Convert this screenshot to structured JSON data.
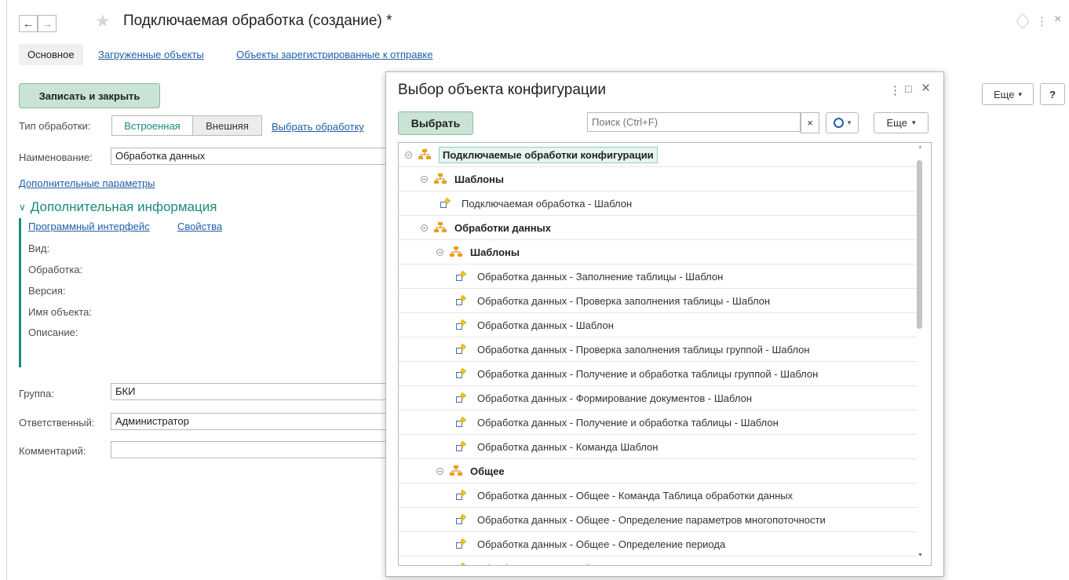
{
  "window": {
    "title": "Подключаемая обработка (создание) *",
    "back": "←",
    "forward": "→",
    "star": "★",
    "link_icon": "🔗",
    "more_icon": "⋮",
    "close_icon": "×"
  },
  "tabs": [
    {
      "label": "Основное"
    },
    {
      "label": "Загруженные объекты"
    },
    {
      "label": "Объекты зарегистрированные к отправке"
    }
  ],
  "toolbar": {
    "save_close": "Записать и закрыть",
    "more": "Еще",
    "help": "?"
  },
  "form": {
    "type_label": "Тип обработки:",
    "type_builtin": "Встроенная",
    "type_external": "Внешняя",
    "choose_processing": "Выбрать обработку",
    "name_label": "Наименование:",
    "name_value": "Обработка данных",
    "extra_params": "Дополнительные параметры",
    "extra_info_title": "Дополнительная информация",
    "program_interface": "Программный интерфейс",
    "properties": "Свойства",
    "kind_label": "Вид:",
    "processing_label": "Обработка:",
    "version_label": "Версия:",
    "object_name_label": "Имя объекта:",
    "description_label": "Описание:",
    "group_label": "Группа:",
    "group_value": "БКИ",
    "responsible_label": "Ответственный:",
    "responsible_value": "Администратор",
    "comment_label": "Комментарий:",
    "comment_value": ""
  },
  "dialog": {
    "title": "Выбор объекта конфигурации",
    "select_button": "Выбрать",
    "search_placeholder": "Поиск (Ctrl+F)",
    "clear_icon": "×",
    "search_icon": "🔍",
    "more": "Еще",
    "dropdown_arrow": "▾",
    "menu_icon": "⋮",
    "maximize_icon": "□",
    "close_icon": "×",
    "tree": [
      {
        "label": "Подключаемые обработки конфигурации",
        "type": "folder",
        "level": 0,
        "selected": true
      },
      {
        "label": "Шаблоны",
        "type": "folder",
        "level": 1
      },
      {
        "label": "Подключаемая обработка - Шаблон",
        "type": "item",
        "level": 2
      },
      {
        "label": "Обработки данных",
        "type": "folder",
        "level": 1
      },
      {
        "label": "Шаблоны",
        "type": "folder",
        "level": 2
      },
      {
        "label": "Обработка данных - Заполнение таблицы - Шаблон",
        "type": "item",
        "level": 3
      },
      {
        "label": "Обработка данных - Проверка заполнения таблицы - Шаблон",
        "type": "item",
        "level": 3
      },
      {
        "label": "Обработка данных - Шаблон",
        "type": "item",
        "level": 3
      },
      {
        "label": "Обработка данных - Проверка заполнения таблицы группой - Шаблон",
        "type": "item",
        "level": 3
      },
      {
        "label": "Обработка данных - Получение и обработка таблицы группой - Шаблон",
        "type": "item",
        "level": 3
      },
      {
        "label": "Обработка данных - Формирование документов - Шаблон",
        "type": "item",
        "level": 3
      },
      {
        "label": "Обработка данных - Получение и обработка таблицы - Шаблон",
        "type": "item",
        "level": 3
      },
      {
        "label": "Обработка данных - Команда Шаблон",
        "type": "item",
        "level": 3
      },
      {
        "label": "Общее",
        "type": "folder",
        "level": 2
      },
      {
        "label": "Обработка данных - Общее - Команда Таблица обработки данных",
        "type": "item",
        "level": 3
      },
      {
        "label": "Обработка данных - Общее - Определение параметров многопоточности",
        "type": "item",
        "level": 3
      },
      {
        "label": "Обработка данных - Общее - Определение периода",
        "type": "item",
        "level": 3
      },
      {
        "label": "Обработка данных - Общее - Определение параметров",
        "type": "item",
        "level": 3
      }
    ]
  },
  "colors": {
    "accent_green": "#c9e3d5",
    "link": "#1f5fa8",
    "section_teal": "#1a8a7a"
  }
}
